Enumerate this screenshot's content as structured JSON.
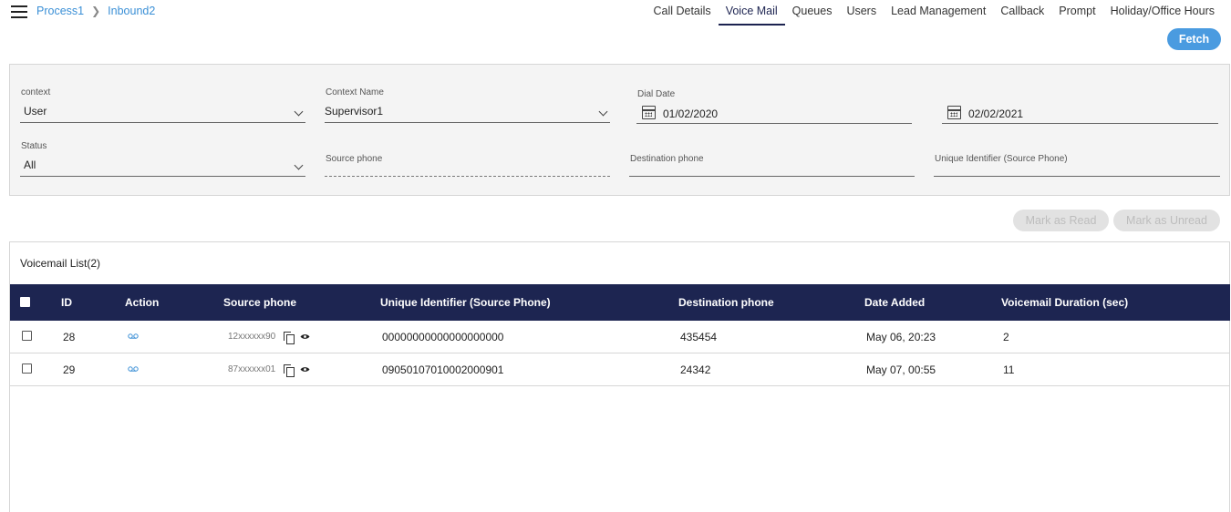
{
  "breadcrumb": {
    "items": [
      "Process1",
      "Inbound2"
    ]
  },
  "nav": {
    "tabs": [
      "Call Details",
      "Voice Mail",
      "Queues",
      "Users",
      "Lead Management",
      "Callback",
      "Prompt",
      "Holiday/Office Hours"
    ],
    "active": "Voice Mail"
  },
  "fetch_label": "Fetch",
  "filters": {
    "context": {
      "label": "context",
      "value": "User"
    },
    "context_name": {
      "label": "Context Name",
      "value": "Supervisor1"
    },
    "dial_date": {
      "label": "Dial Date",
      "from": "01/02/2020",
      "to": "02/02/2021"
    },
    "status": {
      "label": "Status",
      "value": "All"
    },
    "source_phone": {
      "placeholder": "Source phone"
    },
    "destination_phone": {
      "placeholder": "Destination phone"
    },
    "unique_identifier": {
      "placeholder": "Unique Identifier (Source Phone)"
    }
  },
  "actions": {
    "mark_read": "Mark as Read",
    "mark_unread": "Mark as Unread"
  },
  "list": {
    "title": "Voicemail List(2)",
    "columns": [
      "ID",
      "Action",
      "Source phone",
      "Unique Identifier (Source Phone)",
      "Destination phone",
      "Date Added",
      "Voicemail Duration (sec)"
    ],
    "rows": [
      {
        "id": "28",
        "source": "12xxxxxx90",
        "unique_id": "00000000000000000000",
        "destination": "435454",
        "date": "May 06, 20:23",
        "duration": "2"
      },
      {
        "id": "29",
        "source": "87xxxxxx01",
        "unique_id": "09050107010002000901",
        "destination": "24342",
        "date": "May 07, 00:55",
        "duration": "11"
      }
    ]
  },
  "colors": {
    "header_bg": "#1d2551",
    "accent": "#4a9be0",
    "link": "#3a8fd6"
  }
}
